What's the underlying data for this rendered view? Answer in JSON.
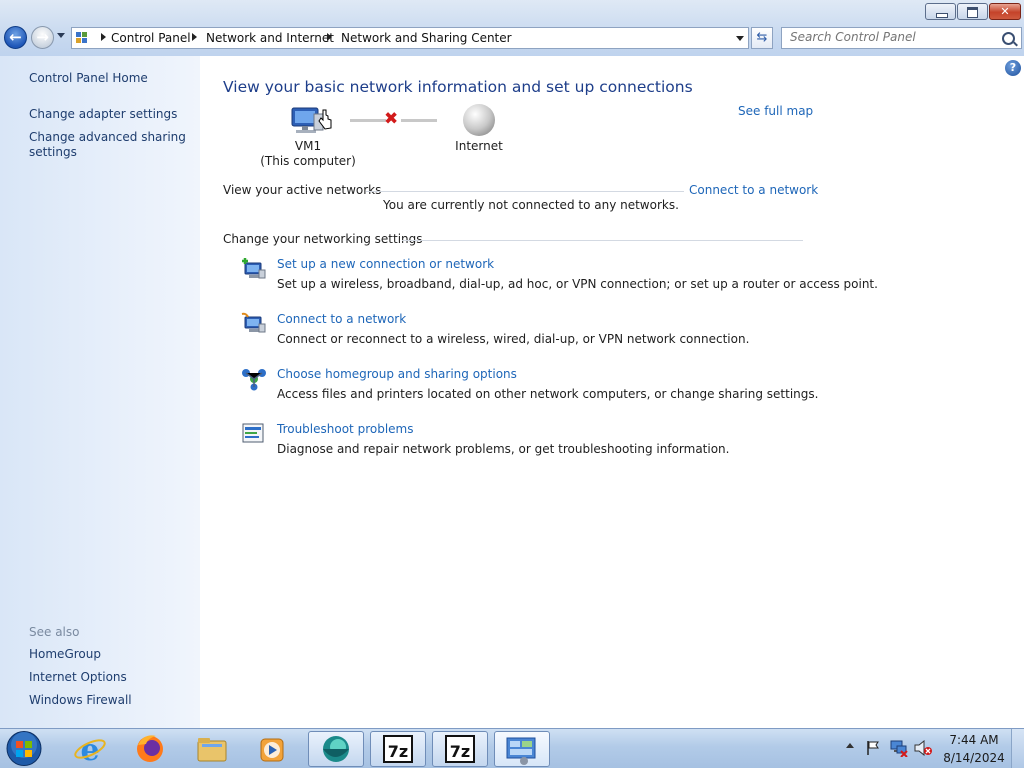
{
  "window": {
    "title": "Network and Sharing Center",
    "controls": [
      "minimize",
      "maximize",
      "close"
    ]
  },
  "address_bar": {
    "breadcrumbs": [
      "Control Panel",
      "Network and Internet",
      "Network and Sharing Center"
    ],
    "search_placeholder": "Search Control Panel"
  },
  "sidebar": {
    "home": "Control Panel Home",
    "links": [
      "Change adapter settings",
      "Change advanced sharing settings"
    ],
    "see_also_heading": "See also",
    "see_also": [
      "HomeGroup",
      "Internet Options",
      "Windows Firewall"
    ]
  },
  "main": {
    "title": "View your basic network information and set up connections",
    "see_full_map": "See full map",
    "map": {
      "computer_name": "VM1",
      "computer_sub": "(This computer)",
      "internet": "Internet",
      "status_icon": "red-x-icon"
    },
    "active_networks": {
      "heading": "View your active networks",
      "connect_link": "Connect to a network",
      "status": "You are currently not connected to any networks."
    },
    "settings": {
      "heading": "Change your networking settings",
      "tasks": [
        {
          "title": "Set up a new connection or network",
          "desc": "Set up a wireless, broadband, dial-up, ad hoc, or VPN connection; or set up a router or access point.",
          "icon": "new-connection-icon"
        },
        {
          "title": "Connect to a network",
          "desc": "Connect or reconnect to a wireless, wired, dial-up, or VPN network connection.",
          "icon": "connect-network-icon"
        },
        {
          "title": "Choose homegroup and sharing options",
          "desc": "Access files and printers located on other network computers, or change sharing settings.",
          "icon": "homegroup-icon"
        },
        {
          "title": "Troubleshoot problems",
          "desc": "Diagnose and repair network problems, or get troubleshooting information.",
          "icon": "troubleshoot-icon"
        }
      ]
    }
  },
  "taskbar": {
    "items": [
      "Internet Explorer",
      "Firefox",
      "Windows Explorer",
      "Windows Media Player",
      "App",
      "7-Zip",
      "7-Zip",
      "Network and Sharing Center"
    ],
    "seven_zip_label": "7z",
    "clock_time": "7:44 AM",
    "clock_date": "8/14/2024"
  },
  "colors": {
    "link": "#1e66b8",
    "title": "#1e3e8a",
    "sidebar_link": "#1e3d6e",
    "sidebar_bg": "#e2ecf8",
    "taskbar_bg": "#b2cbe8"
  }
}
